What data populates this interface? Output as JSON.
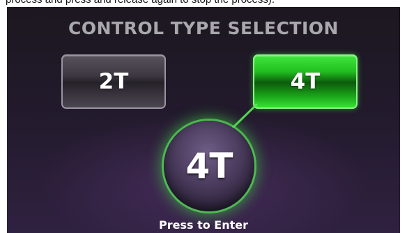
{
  "caption": {
    "text": "process and press and release again to stop the process)."
  },
  "screen": {
    "title": "CONTROL TYPE SELECTION",
    "options": [
      {
        "label": "2T",
        "selected": false
      },
      {
        "label": "4T",
        "selected": true
      }
    ],
    "knob": {
      "label": "4T"
    },
    "hint": "Press to Enter",
    "colors": {
      "selected_accent": "#22c020",
      "glow": "#3ce63c",
      "background": "#221a2c"
    }
  }
}
